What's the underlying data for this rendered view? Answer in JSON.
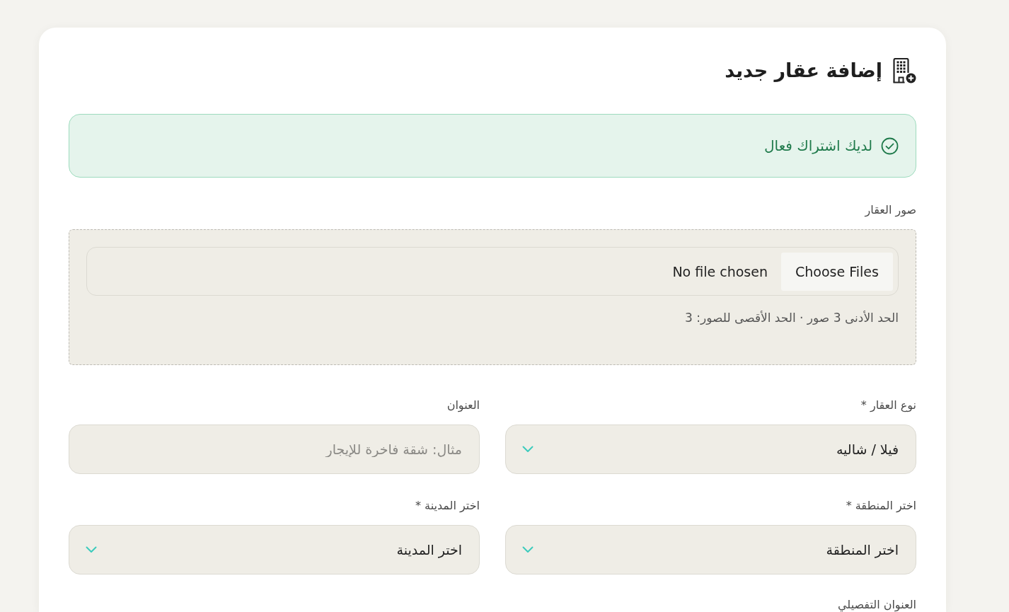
{
  "page": {
    "title": "إضافة عقار جديد"
  },
  "subscription_alert": {
    "text": "لديك اشتراك فعال"
  },
  "property_images": {
    "label": "صور العقار",
    "button": "Choose Files",
    "status": "No file chosen",
    "hint": "الحد الأدنى 3 صور · الحد الأقصى للصور: 3"
  },
  "fields": [
    {
      "kind": "select",
      "label": "نوع العقار *",
      "value": "فيلا / شاليه"
    },
    {
      "kind": "text",
      "label": "العنوان",
      "placeholder": "مثال: شقة فاخرة للإيجار"
    },
    {
      "kind": "select",
      "label": "اختر المنطقة *",
      "value": "اختر المنطقة"
    },
    {
      "kind": "select",
      "label": "اختر المدينة *",
      "value": "اختر المدينة"
    }
  ],
  "detail_address": {
    "label": "العنوان التفصيلي"
  }
}
